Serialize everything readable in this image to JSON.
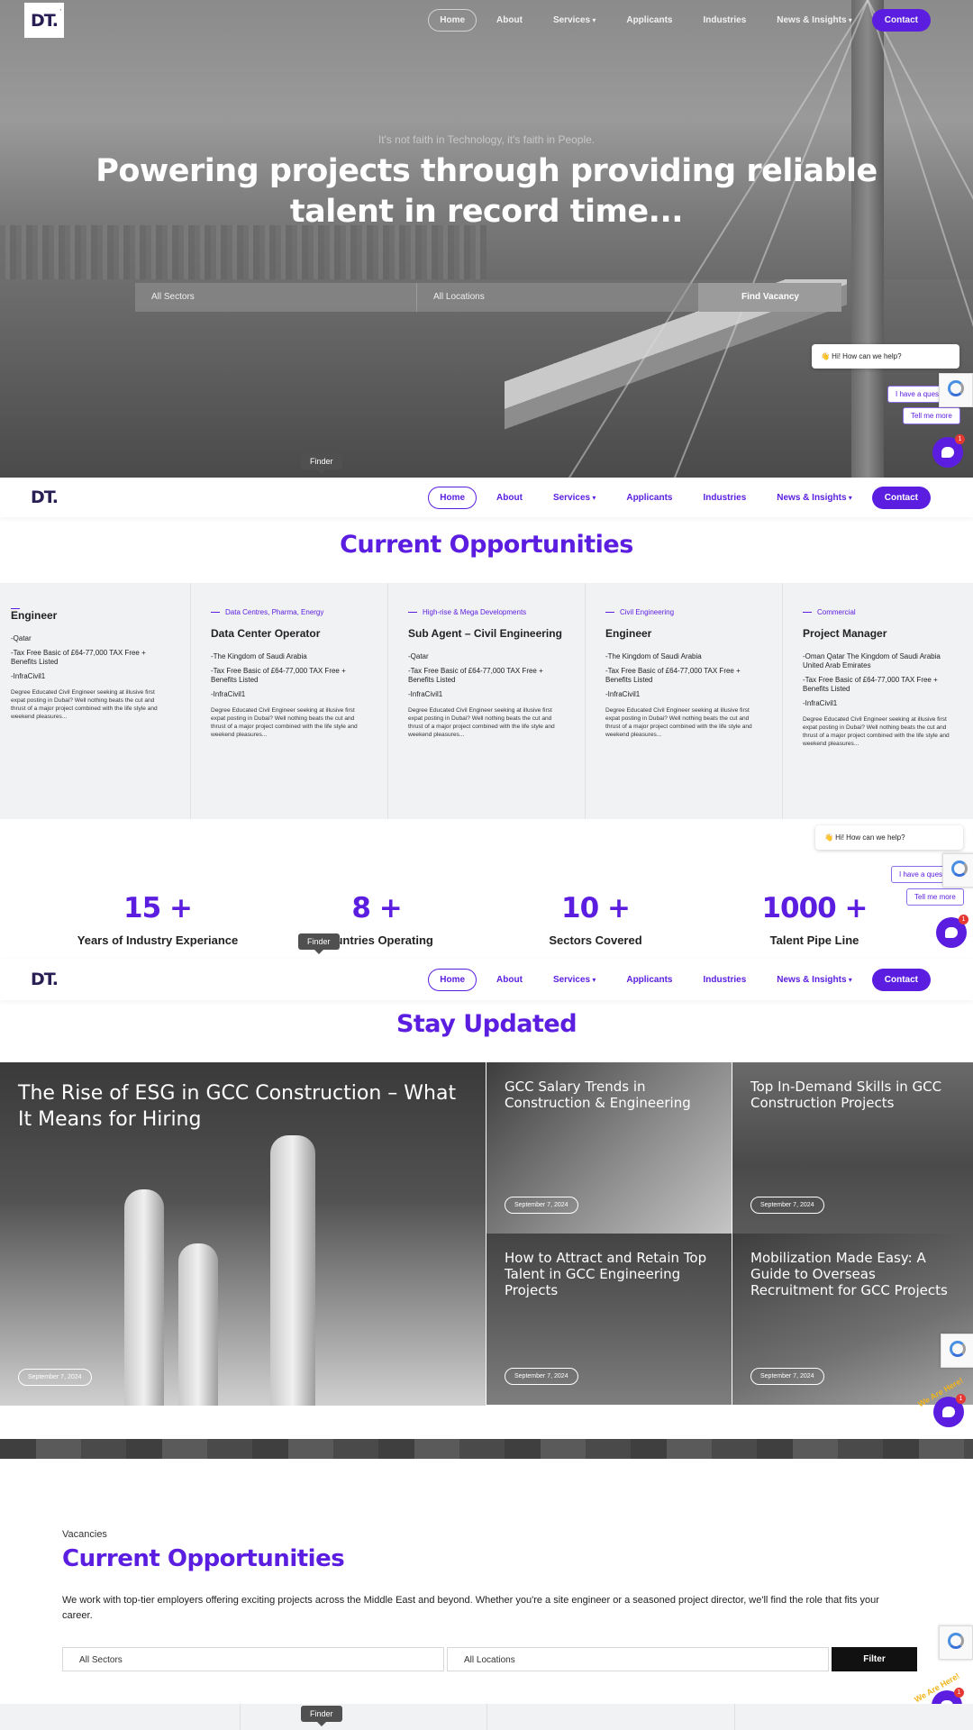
{
  "nav": {
    "logo_text": "DT.",
    "items": [
      "Home",
      "About",
      "Services",
      "Applicants",
      "Industries",
      "News & Insights"
    ],
    "contact_label": "Contact"
  },
  "hero": {
    "tagline": "It's not faith in Technology, it's faith in People.",
    "headline": "Powering projects through providing reliable talent in record time...",
    "sector_placeholder": "All Sectors",
    "location_placeholder": "All Locations",
    "find_button": "Find Vacancy"
  },
  "chat": {
    "greeting": "👋 Hi! How can we help?",
    "option_question": "I have a question",
    "option_more": "Tell me more",
    "badge_count": "1",
    "sticker": "We Are Here!"
  },
  "finder_label": "Finder",
  "opportunities": {
    "title": "Current Opportunities",
    "cards": [
      {
        "category": "",
        "title": "Engineer",
        "location": "-Qatar",
        "salary": "-Tax Free Basic of £64-77,000 TAX Free + Benefits Listed",
        "company": "-InfraCivil1",
        "desc": "Degree Educated Civil Engineer seeking at illusive first expat posting in Dubai? Well nothing beats the cut and thrust of a major project combined with the life style and weekend pleasures..."
      },
      {
        "category": "Data Centres, Pharma, Energy",
        "title": "Data Center Operator",
        "location": "-The Kingdom of Saudi Arabia",
        "salary": "-Tax Free Basic of £64-77,000 TAX Free + Benefits Listed",
        "company": "-InfraCivil1",
        "desc": "Degree Educated Civil Engineer seeking at illusive first expat posting in Dubai? Well nothing beats the cut and thrust of a major project combined with the life style and weekend pleasures..."
      },
      {
        "category": "High-rise & Mega Developments",
        "title": "Sub Agent – Civil Engineering",
        "location": "-Qatar",
        "salary": "-Tax Free Basic of £64-77,000 TAX Free + Benefits Listed",
        "company": "-InfraCivil1",
        "desc": "Degree Educated Civil Engineer seeking at illusive first expat posting in Dubai? Well nothing beats the cut and thrust of a major project combined with the life style and weekend pleasures..."
      },
      {
        "category": "Civil Engineering",
        "title": "Engineer",
        "location": "-The Kingdom of Saudi Arabia",
        "salary": "-Tax Free Basic of £64-77,000 TAX Free + Benefits Listed",
        "company": "-InfraCivil1",
        "desc": "Degree Educated Civil Engineer seeking at illusive first expat posting in Dubai? Well nothing beats the cut and thrust of a major project combined with the life style and weekend pleasures..."
      },
      {
        "category": "Commercial",
        "title": "Project Manager",
        "location": "-Oman Qatar The Kingdom of Saudi Arabia United Arab Emirates",
        "salary": "-Tax Free Basic of £64-77,000 TAX Free + Benefits Listed",
        "company": "-InfraCivil1",
        "desc": "Degree Educated Civil Engineer seeking at illusive first expat posting in Dubai? Well nothing beats the cut and thrust of a major project combined with the life style and weekend pleasures..."
      }
    ]
  },
  "stats": [
    {
      "value": "15 +",
      "label": "Years of Industry Experiance"
    },
    {
      "value": "8 +",
      "label": "Countries Operating"
    },
    {
      "value": "10 +",
      "label": "Sectors Covered"
    },
    {
      "value": "1000 +",
      "label": "Talent Pipe Line"
    }
  ],
  "updates": {
    "title": "Stay Updated",
    "featured": {
      "title": "The Rise of ESG in GCC Construction – What It Means for Hiring",
      "date": "September 7, 2024"
    },
    "posts": [
      {
        "title": "GCC Salary Trends in Construction & Engineering",
        "date": "September 7, 2024"
      },
      {
        "title": "Top In-Demand Skills in GCC Construction Projects",
        "date": "September 7, 2024"
      },
      {
        "title": "How to Attract and Retain Top Talent in GCC Engineering Projects",
        "date": "September 7, 2024"
      },
      {
        "title": "Mobilization Made Easy: A Guide to Overseas Recruitment for GCC Projects",
        "date": "September 7, 2024"
      }
    ]
  },
  "vacancies": {
    "kicker": "Vacancies",
    "title": "Current Opportunities",
    "body": "We work with top-tier employers offering exciting projects across the Middle East and beyond. Whether you're a site engineer or a seasoned project director, we'll find the role that fits your career.",
    "sector_placeholder": "All Sectors",
    "location_placeholder": "All Locations",
    "filter_button": "Filter"
  },
  "colors": {
    "brand": "#5b1ee0",
    "chat": "#5b1ee0",
    "badge": "#e53935"
  }
}
